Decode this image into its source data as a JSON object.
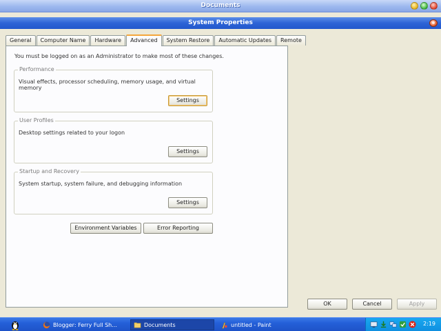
{
  "outer_window": {
    "title": "Documents"
  },
  "dialog": {
    "title": "System Properties",
    "tabs": [
      {
        "label": "General"
      },
      {
        "label": "Computer Name"
      },
      {
        "label": "Hardware"
      },
      {
        "label": "Advanced",
        "active": true
      },
      {
        "label": "System Restore"
      },
      {
        "label": "Automatic Updates"
      },
      {
        "label": "Remote"
      }
    ],
    "intro": "You must be logged on as an Administrator to make most of these changes.",
    "groups": {
      "performance": {
        "title": "Performance",
        "description": "Visual effects, processor scheduling, memory usage, and virtual memory",
        "button": "Settings"
      },
      "user_profiles": {
        "title": "User Profiles",
        "description": "Desktop settings related to your logon",
        "button": "Settings"
      },
      "startup_recovery": {
        "title": "Startup and Recovery",
        "description": "System startup, system failure, and debugging information",
        "button": "Settings"
      }
    },
    "environment_variables_button": "Environment Variables",
    "error_reporting_button": "Error Reporting",
    "footer": {
      "ok": "OK",
      "cancel": "Cancel",
      "apply": "Apply"
    }
  },
  "taskbar": {
    "tasks": [
      {
        "label": "Blogger: Ferry Full Sh...",
        "icon": "firefox-icon"
      },
      {
        "label": "Documents",
        "icon": "folder-icon",
        "active": true
      },
      {
        "label": "untitled - Paint",
        "icon": "paint-icon"
      }
    ],
    "clock": "2:19"
  },
  "colors": {
    "dialog_titlebar": "#2d63d6",
    "taskbar": "#245fd8",
    "tray": "#0f8fe0",
    "active_tab_accent": "#f4a63a"
  }
}
